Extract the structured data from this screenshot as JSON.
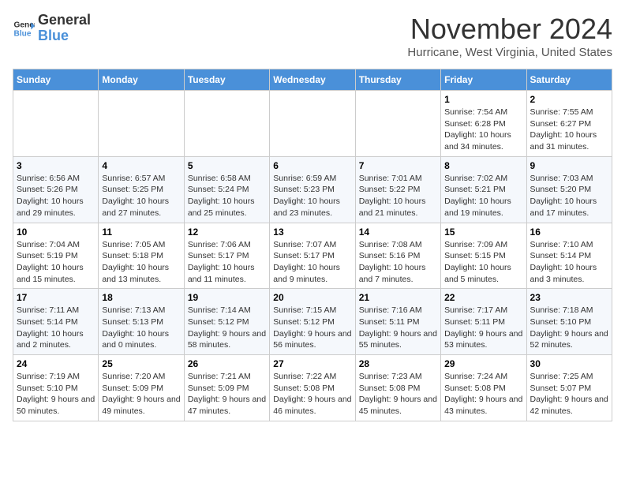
{
  "header": {
    "logo_line1": "General",
    "logo_line2": "Blue",
    "month": "November 2024",
    "location": "Hurricane, West Virginia, United States"
  },
  "weekdays": [
    "Sunday",
    "Monday",
    "Tuesday",
    "Wednesday",
    "Thursday",
    "Friday",
    "Saturday"
  ],
  "weeks": [
    [
      {
        "day": "",
        "info": ""
      },
      {
        "day": "",
        "info": ""
      },
      {
        "day": "",
        "info": ""
      },
      {
        "day": "",
        "info": ""
      },
      {
        "day": "",
        "info": ""
      },
      {
        "day": "1",
        "info": "Sunrise: 7:54 AM\nSunset: 6:28 PM\nDaylight: 10 hours and 34 minutes."
      },
      {
        "day": "2",
        "info": "Sunrise: 7:55 AM\nSunset: 6:27 PM\nDaylight: 10 hours and 31 minutes."
      }
    ],
    [
      {
        "day": "3",
        "info": "Sunrise: 6:56 AM\nSunset: 5:26 PM\nDaylight: 10 hours and 29 minutes."
      },
      {
        "day": "4",
        "info": "Sunrise: 6:57 AM\nSunset: 5:25 PM\nDaylight: 10 hours and 27 minutes."
      },
      {
        "day": "5",
        "info": "Sunrise: 6:58 AM\nSunset: 5:24 PM\nDaylight: 10 hours and 25 minutes."
      },
      {
        "day": "6",
        "info": "Sunrise: 6:59 AM\nSunset: 5:23 PM\nDaylight: 10 hours and 23 minutes."
      },
      {
        "day": "7",
        "info": "Sunrise: 7:01 AM\nSunset: 5:22 PM\nDaylight: 10 hours and 21 minutes."
      },
      {
        "day": "8",
        "info": "Sunrise: 7:02 AM\nSunset: 5:21 PM\nDaylight: 10 hours and 19 minutes."
      },
      {
        "day": "9",
        "info": "Sunrise: 7:03 AM\nSunset: 5:20 PM\nDaylight: 10 hours and 17 minutes."
      }
    ],
    [
      {
        "day": "10",
        "info": "Sunrise: 7:04 AM\nSunset: 5:19 PM\nDaylight: 10 hours and 15 minutes."
      },
      {
        "day": "11",
        "info": "Sunrise: 7:05 AM\nSunset: 5:18 PM\nDaylight: 10 hours and 13 minutes."
      },
      {
        "day": "12",
        "info": "Sunrise: 7:06 AM\nSunset: 5:17 PM\nDaylight: 10 hours and 11 minutes."
      },
      {
        "day": "13",
        "info": "Sunrise: 7:07 AM\nSunset: 5:17 PM\nDaylight: 10 hours and 9 minutes."
      },
      {
        "day": "14",
        "info": "Sunrise: 7:08 AM\nSunset: 5:16 PM\nDaylight: 10 hours and 7 minutes."
      },
      {
        "day": "15",
        "info": "Sunrise: 7:09 AM\nSunset: 5:15 PM\nDaylight: 10 hours and 5 minutes."
      },
      {
        "day": "16",
        "info": "Sunrise: 7:10 AM\nSunset: 5:14 PM\nDaylight: 10 hours and 3 minutes."
      }
    ],
    [
      {
        "day": "17",
        "info": "Sunrise: 7:11 AM\nSunset: 5:14 PM\nDaylight: 10 hours and 2 minutes."
      },
      {
        "day": "18",
        "info": "Sunrise: 7:13 AM\nSunset: 5:13 PM\nDaylight: 10 hours and 0 minutes."
      },
      {
        "day": "19",
        "info": "Sunrise: 7:14 AM\nSunset: 5:12 PM\nDaylight: 9 hours and 58 minutes."
      },
      {
        "day": "20",
        "info": "Sunrise: 7:15 AM\nSunset: 5:12 PM\nDaylight: 9 hours and 56 minutes."
      },
      {
        "day": "21",
        "info": "Sunrise: 7:16 AM\nSunset: 5:11 PM\nDaylight: 9 hours and 55 minutes."
      },
      {
        "day": "22",
        "info": "Sunrise: 7:17 AM\nSunset: 5:11 PM\nDaylight: 9 hours and 53 minutes."
      },
      {
        "day": "23",
        "info": "Sunrise: 7:18 AM\nSunset: 5:10 PM\nDaylight: 9 hours and 52 minutes."
      }
    ],
    [
      {
        "day": "24",
        "info": "Sunrise: 7:19 AM\nSunset: 5:10 PM\nDaylight: 9 hours and 50 minutes."
      },
      {
        "day": "25",
        "info": "Sunrise: 7:20 AM\nSunset: 5:09 PM\nDaylight: 9 hours and 49 minutes."
      },
      {
        "day": "26",
        "info": "Sunrise: 7:21 AM\nSunset: 5:09 PM\nDaylight: 9 hours and 47 minutes."
      },
      {
        "day": "27",
        "info": "Sunrise: 7:22 AM\nSunset: 5:08 PM\nDaylight: 9 hours and 46 minutes."
      },
      {
        "day": "28",
        "info": "Sunrise: 7:23 AM\nSunset: 5:08 PM\nDaylight: 9 hours and 45 minutes."
      },
      {
        "day": "29",
        "info": "Sunrise: 7:24 AM\nSunset: 5:08 PM\nDaylight: 9 hours and 43 minutes."
      },
      {
        "day": "30",
        "info": "Sunrise: 7:25 AM\nSunset: 5:07 PM\nDaylight: 9 hours and 42 minutes."
      }
    ]
  ]
}
